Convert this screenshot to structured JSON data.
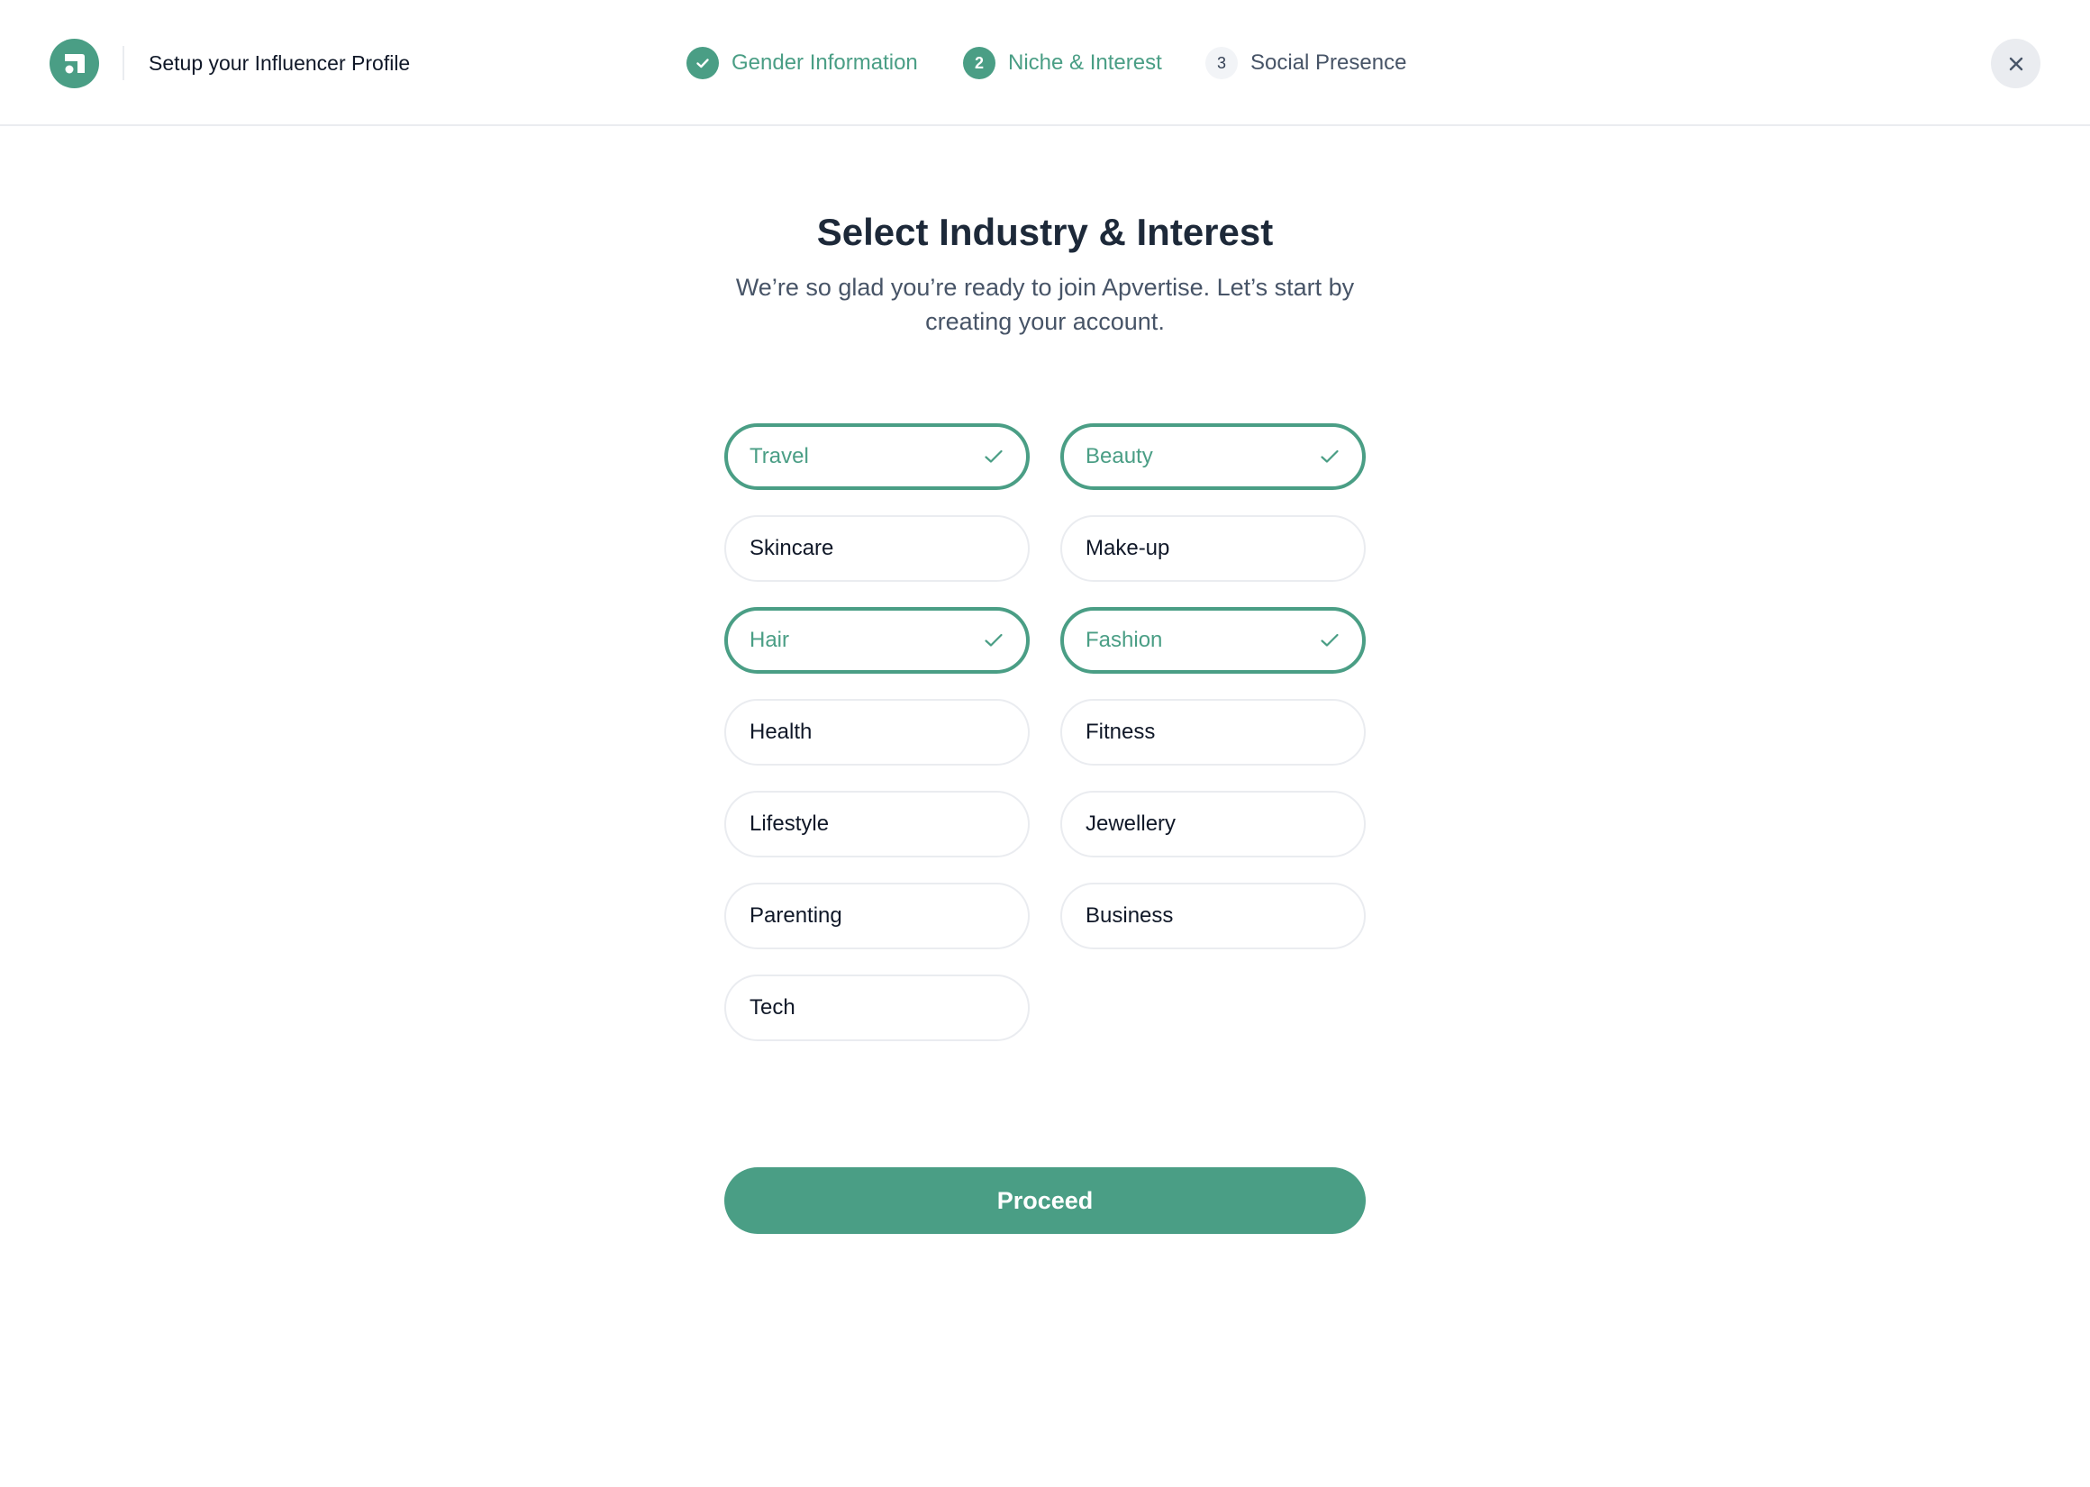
{
  "header": {
    "title": "Setup your Influencer Profile",
    "logo_icon": "apvertise-logo-icon",
    "close_icon": "close-icon"
  },
  "steps": [
    {
      "label": "Gender Information",
      "number": "",
      "state": "done",
      "icon": "check-icon"
    },
    {
      "label": "Niche & Interest",
      "number": "2",
      "state": "active",
      "icon": ""
    },
    {
      "label": "Social Presence",
      "number": "3",
      "state": "pending",
      "icon": ""
    }
  ],
  "main": {
    "title": "Select Industry & Interest",
    "subtitle": "We’re so glad you’re ready to join Apvertise. Let’s start by creating your account."
  },
  "interests": [
    {
      "label": "Travel",
      "selected": true
    },
    {
      "label": "Beauty",
      "selected": true
    },
    {
      "label": "Skincare",
      "selected": false
    },
    {
      "label": "Make-up",
      "selected": false
    },
    {
      "label": "Hair",
      "selected": true
    },
    {
      "label": "Fashion",
      "selected": true
    },
    {
      "label": "Health",
      "selected": false
    },
    {
      "label": "Fitness",
      "selected": false
    },
    {
      "label": "Lifestyle",
      "selected": false
    },
    {
      "label": "Jewellery",
      "selected": false
    },
    {
      "label": "Parenting",
      "selected": false
    },
    {
      "label": "Business",
      "selected": false
    },
    {
      "label": "Tech",
      "selected": false
    }
  ],
  "actions": {
    "proceed_label": "Proceed"
  },
  "colors": {
    "accent": "#4a9e85",
    "border": "#eaecf0",
    "text": "#101828",
    "muted": "#475467"
  }
}
